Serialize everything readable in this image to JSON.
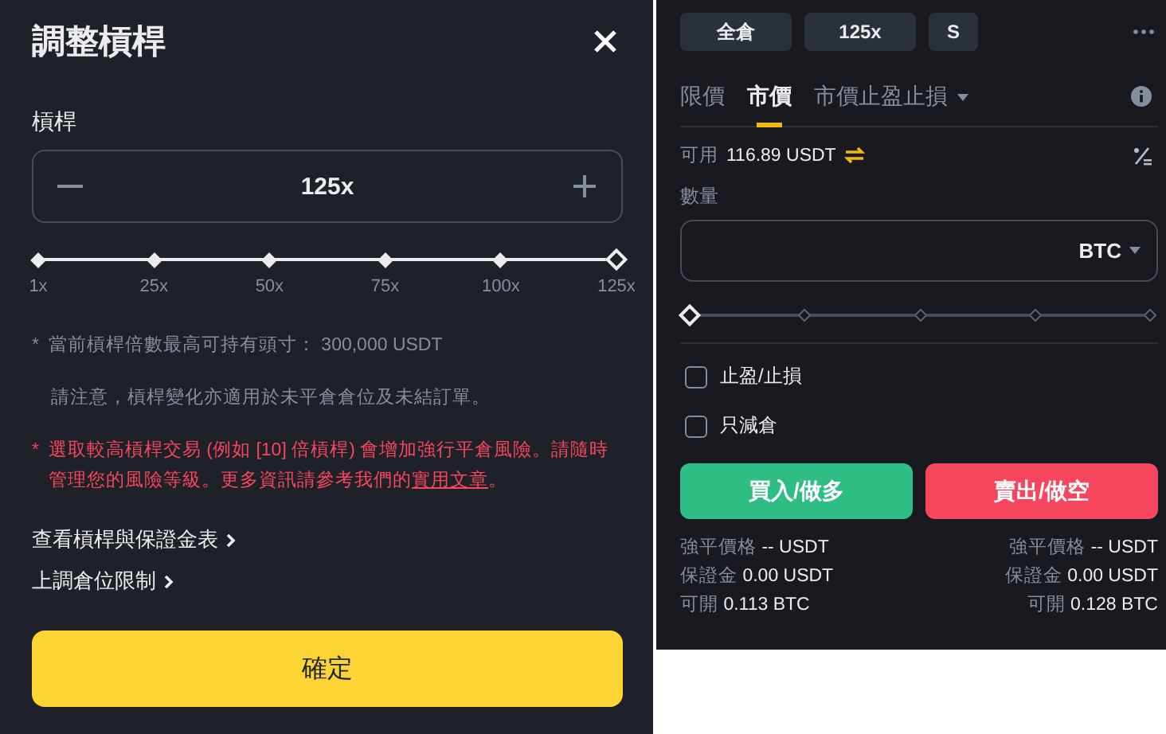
{
  "dialog": {
    "title": "調整槓桿",
    "leverage": {
      "label": "槓桿",
      "value": "125x",
      "level": 1,
      "marks": [
        "1x",
        "25x",
        "50x",
        "75x",
        "100x",
        "125x"
      ]
    },
    "notes": [
      {
        "kind": "info",
        "marker": "*",
        "text": "當前槓桿倍數最高可持有頭寸： 300,000 USDT"
      },
      {
        "kind": "plain",
        "text": "請注意，槓桿變化亦適用於未平倉倉位及未結訂單。"
      },
      {
        "kind": "warning",
        "marker": "*",
        "text": "選取較高槓桿交易 (例如 [10] 倍槓桿) 會增加強行平倉風險。請隨時管理您的風險等級。更多資訊請參考我們的",
        "link": "實用文章",
        "tail": "。"
      }
    ],
    "links": [
      "查看槓桿與保證金表",
      "上調倉位限制"
    ],
    "confirm": "確定"
  },
  "order": {
    "chips": [
      "全倉",
      "125x",
      "S"
    ],
    "tabs": [
      {
        "label": "限價",
        "selected": false,
        "dropdown": false
      },
      {
        "label": "市價",
        "selected": true,
        "dropdown": false
      },
      {
        "label": "市價止盈止損",
        "selected": false,
        "dropdown": true
      }
    ],
    "available": {
      "label": "可用",
      "value": "116.89 USDT"
    },
    "quantity": {
      "label": "數量",
      "unit": "BTC"
    },
    "slider": {
      "level": 0
    },
    "options": [
      {
        "label": "止盈/止損",
        "checked": false
      },
      {
        "label": "只減倉",
        "checked": false
      }
    ],
    "actions": [
      {
        "label": "買入/做多",
        "kind": "buy"
      },
      {
        "label": "賣出/做空",
        "kind": "sell"
      }
    ],
    "summary": [
      {
        "rows": [
          {
            "label": "強平價格",
            "value": "-- USDT"
          },
          {
            "label": "保證金",
            "value": "0.00 USDT"
          },
          {
            "label": "可開",
            "value": "0.113 BTC"
          }
        ]
      },
      {
        "rows": [
          {
            "label": "強平價格",
            "value": "-- USDT"
          },
          {
            "label": "保證金",
            "value": "0.00 USDT"
          },
          {
            "label": "可開",
            "value": "0.128 BTC"
          }
        ]
      }
    ]
  }
}
